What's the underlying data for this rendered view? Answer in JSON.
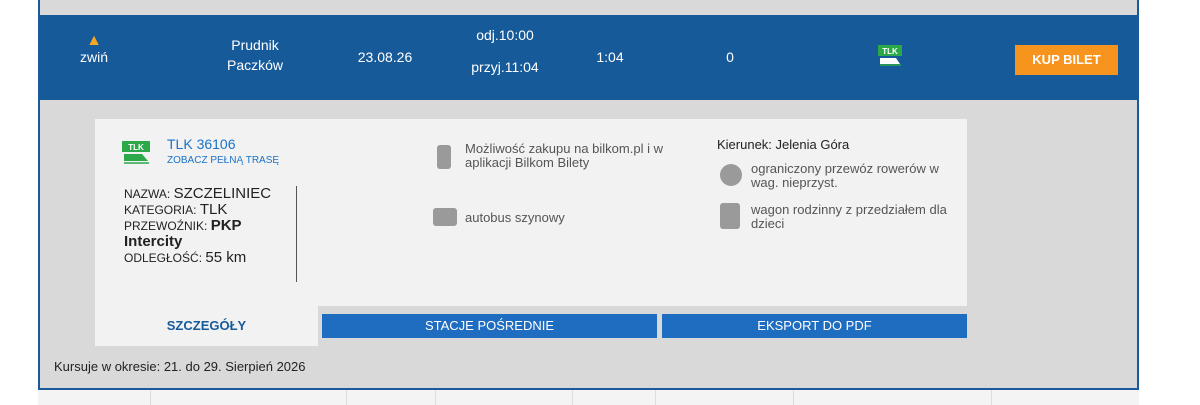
{
  "connection": {
    "collapse_label": "zwiń",
    "from": "Prudnik",
    "to": "Paczków",
    "date": "23.08.26",
    "departure": "odj.10:00",
    "arrival": "przyj.11:04",
    "duration": "1:04",
    "changes": "0",
    "carrier_logo": "TLK",
    "buy_label": "KUP BILET"
  },
  "details": {
    "train_number": "TLK 36106",
    "full_route_link": "ZOBACZ PEŁNĄ TRASĘ",
    "name_label": "NAZWA:",
    "name_value": "SZCZELINIEC",
    "category_label": "KATEGORIA:",
    "category_value": "TLK",
    "carrier_label": "PRZEWOŹNIK:",
    "carrier_value_1": "PKP",
    "carrier_value_2": "Intercity",
    "distance_label": "ODLEGŁOŚĆ:",
    "distance_value": "55  km",
    "purchase_info": "Możliwość zakupu na bilkom.pl i w aplikacji Bilkom Bilety",
    "railbus": "autobus szynowy",
    "direction": "Kierunek: Jelenia Góra",
    "bikes": "ograniczony przewóz rowerów w wag. nieprzyst.",
    "family": "wagon rodzinny z przedziałem dla dzieci"
  },
  "tabs": {
    "details": "SZCZEGÓŁY",
    "stations": "STACJE POŚREDNIE",
    "pdf": "EKSPORT DO PDF"
  },
  "period_note": "Kursuje w okresie: 21. do 29. Sierpień 2026",
  "colors": {
    "header_blue": "#175a9a",
    "accent_orange": "#f7941d",
    "tab_blue": "#1f6dc0",
    "tlk_green": "#2aa84a"
  },
  "icons": [
    "chevron-up-icon",
    "tlk-logo-icon",
    "phone-icon",
    "railbus-icon",
    "bicycle-icon",
    "family-icon"
  ]
}
